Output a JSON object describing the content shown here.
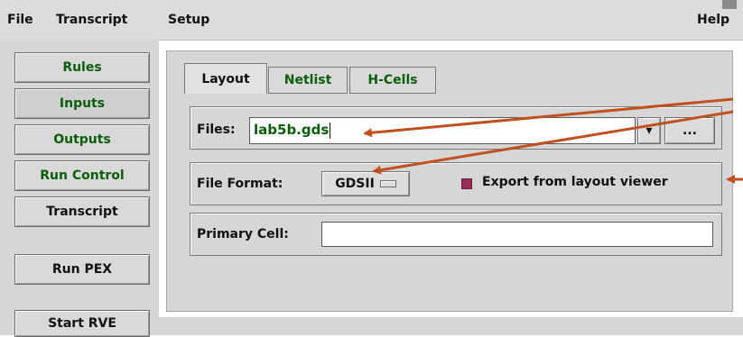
{
  "menubar": {
    "file": "File",
    "transcript": "Transcript",
    "setup": "Setup",
    "help": "Help"
  },
  "left_panel": {
    "buttons": [
      {
        "label": "Rules"
      },
      {
        "label": "Inputs"
      },
      {
        "label": "Outputs"
      },
      {
        "label": "Run Control"
      },
      {
        "label": "Transcript"
      },
      {
        "label": "Run PEX"
      },
      {
        "label": "Start RVE"
      }
    ]
  },
  "tabs": [
    {
      "label": "Layout"
    },
    {
      "label": "Netlist"
    },
    {
      "label": "H-Cells"
    }
  ],
  "files": {
    "label": "Files:",
    "value": "lab5b.gds",
    "browse_label": "..."
  },
  "file_format": {
    "label": "File Format:",
    "value": "GDSII",
    "export_label": "Export from layout viewer"
  },
  "primary_cell": {
    "label": "Primary Cell:",
    "value": ""
  },
  "colors": {
    "accent_green": "#0a5d0a",
    "annotation_arrow": "#c0501f",
    "checkbox": "#9b2d58"
  }
}
